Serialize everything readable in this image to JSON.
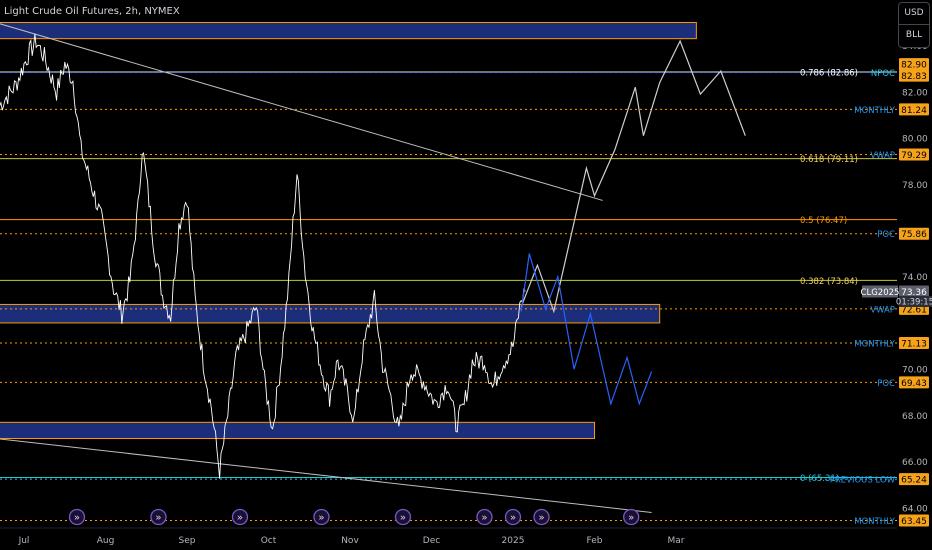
{
  "chart_data": {
    "type": "line",
    "title": "Light Crude Oil Futures, 2h, NYMEX",
    "units": [
      "USD",
      "BLL"
    ],
    "price_ticks": [
      "84.00",
      "82.00",
      "80.00",
      "78.00",
      "74.00",
      "70.00",
      "68.00",
      "66.00",
      "64.00"
    ],
    "ylim": [
      63.3,
      85.8
    ],
    "time_ticks": [
      {
        "label": "Jul",
        "t": 0.3
      },
      {
        "label": "Aug",
        "t": 1.3
      },
      {
        "label": "Sep",
        "t": 2.3
      },
      {
        "label": "Oct",
        "t": 3.3
      },
      {
        "label": "Nov",
        "t": 4.3
      },
      {
        "label": "Dec",
        "t": 5.3
      },
      {
        "label": "2025",
        "t": 6.3
      },
      {
        "label": "Feb",
        "t": 7.3
      },
      {
        "label": "Mar",
        "t": 8.3
      }
    ],
    "price_series": {
      "name": "CLG2025",
      "points": [
        [
          0.0,
          81.4
        ],
        [
          0.2,
          82.3
        ],
        [
          0.35,
          83.6
        ],
        [
          0.45,
          84.2
        ],
        [
          0.55,
          83.5
        ],
        [
          0.7,
          82.0
        ],
        [
          0.8,
          83.2
        ],
        [
          0.9,
          82.5
        ],
        [
          1.0,
          79.5
        ],
        [
          1.1,
          78.3
        ],
        [
          1.25,
          76.5
        ],
        [
          1.4,
          73.5
        ],
        [
          1.5,
          72.4
        ],
        [
          1.6,
          73.8
        ],
        [
          1.7,
          77.0
        ],
        [
          1.75,
          79.6
        ],
        [
          1.8,
          78.3
        ],
        [
          1.9,
          75.2
        ],
        [
          2.0,
          73.2
        ],
        [
          2.1,
          72.3
        ],
        [
          2.2,
          76.2
        ],
        [
          2.3,
          77.5
        ],
        [
          2.4,
          73.0
        ],
        [
          2.5,
          70.3
        ],
        [
          2.6,
          68.3
        ],
        [
          2.7,
          65.6
        ],
        [
          2.8,
          68.0
        ],
        [
          2.9,
          70.5
        ],
        [
          3.05,
          71.8
        ],
        [
          3.15,
          72.7
        ],
        [
          3.25,
          69.5
        ],
        [
          3.35,
          67.4
        ],
        [
          3.45,
          70.2
        ],
        [
          3.55,
          73.8
        ],
        [
          3.6,
          76.3
        ],
        [
          3.65,
          78.5
        ],
        [
          3.75,
          74.2
        ],
        [
          3.85,
          71.6
        ],
        [
          3.95,
          70.0
        ],
        [
          4.05,
          68.8
        ],
        [
          4.15,
          70.4
        ],
        [
          4.25,
          69.2
        ],
        [
          4.35,
          67.8
        ],
        [
          4.45,
          70.6
        ],
        [
          4.55,
          72.3
        ],
        [
          4.6,
          73.0
        ],
        [
          4.7,
          70.2
        ],
        [
          4.8,
          68.8
        ],
        [
          4.9,
          67.3
        ],
        [
          5.05,
          70.0
        ],
        [
          5.2,
          69.5
        ],
        [
          5.35,
          68.5
        ],
        [
          5.5,
          69.4
        ],
        [
          5.6,
          67.6
        ],
        [
          5.7,
          68.4
        ],
        [
          5.8,
          70.3
        ],
        [
          5.95,
          70.4
        ],
        [
          6.05,
          69.2
        ],
        [
          6.15,
          70.1
        ],
        [
          6.3,
          71.0
        ],
        [
          6.4,
          73.0
        ],
        [
          6.45,
          73.36
        ]
      ]
    },
    "projection_up": {
      "points": [
        [
          6.4,
          72.7
        ],
        [
          6.6,
          74.5
        ],
        [
          6.8,
          72.5
        ],
        [
          7.2,
          78.7
        ],
        [
          7.3,
          77.5
        ],
        [
          7.55,
          79.5
        ],
        [
          7.8,
          82.2
        ],
        [
          7.9,
          80.1
        ],
        [
          8.1,
          82.4
        ],
        [
          8.35,
          84.2
        ],
        [
          8.6,
          81.9
        ],
        [
          8.85,
          82.9
        ],
        [
          9.15,
          80.1
        ]
      ]
    },
    "projection_down": {
      "points": [
        [
          6.4,
          72.5
        ],
        [
          6.5,
          75.0
        ],
        [
          6.7,
          72.6
        ],
        [
          6.85,
          74.0
        ],
        [
          7.05,
          70.0
        ],
        [
          7.25,
          72.4
        ],
        [
          7.5,
          68.5
        ],
        [
          7.7,
          70.5
        ],
        [
          7.85,
          68.5
        ],
        [
          8.0,
          69.9
        ]
      ]
    },
    "trendlines": [
      {
        "from": [
          -0.05,
          85.0
        ],
        "to": [
          7.4,
          77.3
        ]
      },
      {
        "from": [
          -0.05,
          67.0
        ],
        "to": [
          8.0,
          63.8
        ]
      }
    ],
    "zones": [
      {
        "t1": -0.05,
        "t2": 8.55,
        "p1": 84.3,
        "p2": 85.0
      },
      {
        "t1": -0.05,
        "t2": 8.1,
        "p1": 72.0,
        "p2": 72.8
      },
      {
        "t1": -0.05,
        "t2": 7.3,
        "p1": 67.0,
        "p2": 67.7
      }
    ],
    "levels": [
      {
        "price": 82.86,
        "color": "#e6e6e6",
        "dash": false,
        "label": "0.786 (82.86)",
        "label_color": "#ffffff"
      },
      {
        "price": 82.83,
        "color": "#2962ff",
        "dash": true,
        "label": "NPOC",
        "label_color": "#26c6da"
      },
      {
        "price": 81.24,
        "color": "#ff9800",
        "dash": true,
        "label": "MONTHLY",
        "label_color": "#2196f3"
      },
      {
        "price": 79.29,
        "color": "#ff9800",
        "dash": true,
        "label": "VWAP",
        "label_color": "#2196f3"
      },
      {
        "price": 79.11,
        "color": "#c0ca33",
        "dash": false,
        "label": "0.618 (79.11)",
        "label_color": "#f5d061"
      },
      {
        "price": 76.47,
        "color": "#ff9800",
        "dash": false,
        "label": "0.5 (76.47)",
        "label_color": "#ff9800"
      },
      {
        "price": 75.86,
        "color": "#ff9800",
        "dash": true,
        "label": "POC",
        "label_color": "#2196f3"
      },
      {
        "price": 73.84,
        "color": "#c0ca33",
        "dash": false,
        "label": "0.382 (73.84)",
        "label_color": "#f5d061"
      },
      {
        "price": 72.61,
        "color": "#ff9800",
        "dash": true,
        "label": "VWAP",
        "label_color": "#2196f3"
      },
      {
        "price": 71.13,
        "color": "#ff9800",
        "dash": true,
        "label": "MONTHLY",
        "label_color": "#2196f3"
      },
      {
        "price": 69.43,
        "color": "#ff9800",
        "dash": true,
        "label": "POC",
        "label_color": "#2196f3"
      },
      {
        "price": 65.31,
        "color": "#26c6da",
        "dash": false,
        "label": "0 (65.31)",
        "label_color": "#26c6da"
      },
      {
        "price": 65.24,
        "color": "#26c6da",
        "dash": true,
        "label": "PREVIOUS LOW",
        "label_color": "#2196f3"
      },
      {
        "price": 63.45,
        "color": "#ff9800",
        "dash": true,
        "label": "MONTHLY",
        "label_color": "#2196f3"
      }
    ],
    "price_tags": [
      {
        "text": "82.90",
        "price": 83.2,
        "bg": "#f7a21b",
        "fg": "#000000"
      },
      {
        "text": "82.83",
        "price": 82.7,
        "bg": "#f7a21b",
        "fg": "#000000"
      },
      {
        "text": "81.24",
        "price": 81.24,
        "bg": "#f7a21b",
        "fg": "#000000"
      },
      {
        "text": "79.29",
        "price": 79.29,
        "bg": "#f7a21b",
        "fg": "#000000"
      },
      {
        "text": "75.86",
        "price": 75.86,
        "bg": "#f7a21b",
        "fg": "#000000"
      },
      {
        "text": "73.36",
        "price": 73.36,
        "bg": "#5d606b",
        "fg": "#ffffff"
      },
      {
        "text": "72.61",
        "price": 72.61,
        "bg": "#f7a21b",
        "fg": "#000000"
      },
      {
        "text": "71.13",
        "price": 71.13,
        "bg": "#f7a21b",
        "fg": "#000000"
      },
      {
        "text": "69.43",
        "price": 69.43,
        "bg": "#f7a21b",
        "fg": "#000000"
      },
      {
        "text": "65.24",
        "price": 65.24,
        "bg": "#f7a21b",
        "fg": "#000000"
      },
      {
        "text": "63.45",
        "price": 63.45,
        "bg": "#f7a21b",
        "fg": "#000000"
      }
    ],
    "symbol_tag": {
      "text": "CLG2025",
      "price": 73.36
    },
    "countdown": {
      "text": "01:39:15",
      "price": 72.95
    },
    "events": [
      0.95,
      1.95,
      2.95,
      3.95,
      4.95,
      5.95,
      6.3,
      6.65,
      7.75
    ],
    "grid": false,
    "colors": {
      "price": "#ffffff",
      "projection_up": "#cfcfcf",
      "projection_down": "#2962ff",
      "zone_fill": "#1c2d7a",
      "zone_border": "#ff9800",
      "event_icon": "#7b57c7"
    }
  }
}
